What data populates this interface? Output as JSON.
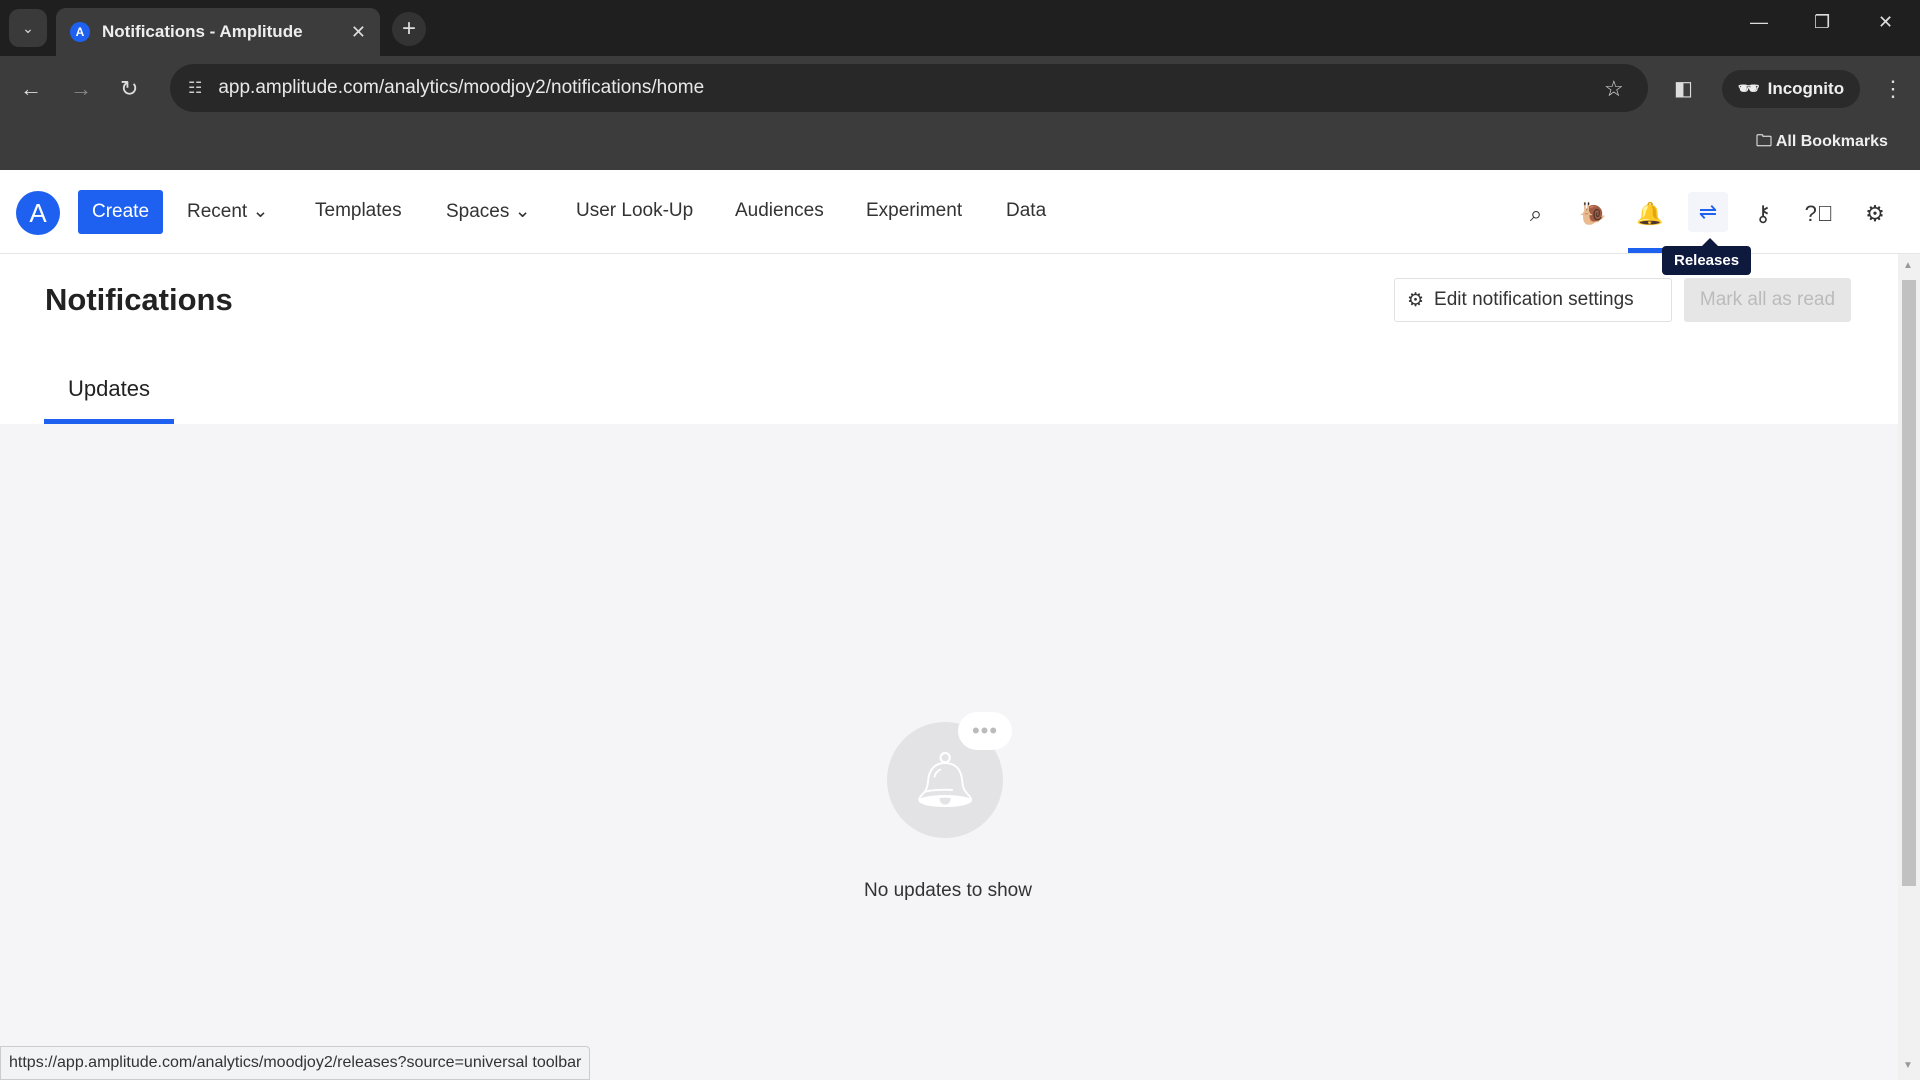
{
  "browser": {
    "tab_title": "Notifications - Amplitude",
    "url": "app.amplitude.com/analytics/moodjoy2/notifications/home",
    "incognito_label": "Incognito",
    "bookmarks_label": "All Bookmarks",
    "status_url": "https://app.amplitude.com/analytics/moodjoy2/releases?source=universal toolbar"
  },
  "nav": {
    "create": "Create",
    "items": [
      "Recent",
      "Templates",
      "Spaces",
      "User Look-Up",
      "Audiences",
      "Experiment",
      "Data"
    ],
    "tooltip": "Releases",
    "accent": "#1e61f0"
  },
  "page": {
    "title": "Notifications",
    "edit_settings": "Edit notification settings",
    "mark_all_read": "Mark all as read",
    "tabs": [
      "Updates"
    ],
    "empty_text": "No updates to show"
  }
}
